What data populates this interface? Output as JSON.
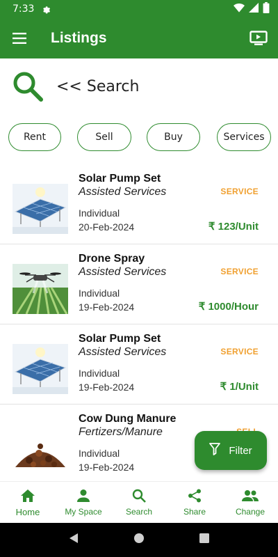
{
  "status_bar": {
    "time": "7:33"
  },
  "app_bar": {
    "title": "Listings"
  },
  "search": {
    "text": "<< Search"
  },
  "chips": [
    "Rent",
    "Sell",
    "Buy",
    "Services"
  ],
  "listings": [
    {
      "title": "Solar Pump Set",
      "category": "Assisted Services",
      "seller_type": "Individual",
      "date": "20-Feb-2024",
      "badge": "SERVICE",
      "price": "₹ 123/Unit",
      "image": "solar-panel"
    },
    {
      "title": "Drone Spray",
      "category": "Assisted Services",
      "seller_type": "Individual",
      "date": "19-Feb-2024",
      "badge": "SERVICE",
      "price": "₹ 1000/Hour",
      "image": "drone"
    },
    {
      "title": "Solar Pump Set",
      "category": "Assisted Services",
      "seller_type": "Individual",
      "date": "19-Feb-2024",
      "badge": "SERVICE",
      "price": "₹ 1/Unit",
      "image": "solar-panel"
    },
    {
      "title": "Cow Dung Manure",
      "category": "Fertizers/Manure",
      "seller_type": "Individual",
      "date": "19-Feb-2024",
      "badge": "SELL",
      "price": "",
      "image": "manure"
    }
  ],
  "fab": {
    "label": "Filter"
  },
  "bottom_nav": [
    {
      "label": "Home",
      "icon": "home-icon",
      "active": true
    },
    {
      "label": "My Space",
      "icon": "person-icon"
    },
    {
      "label": "Search",
      "icon": "search-icon"
    },
    {
      "label": "Share",
      "icon": "share-icon"
    },
    {
      "label": "Change",
      "icon": "people-icon"
    }
  ],
  "colors": {
    "primary": "#2e8b2e",
    "badge": "#f0a030",
    "chip_border": "#2e8b2e"
  }
}
